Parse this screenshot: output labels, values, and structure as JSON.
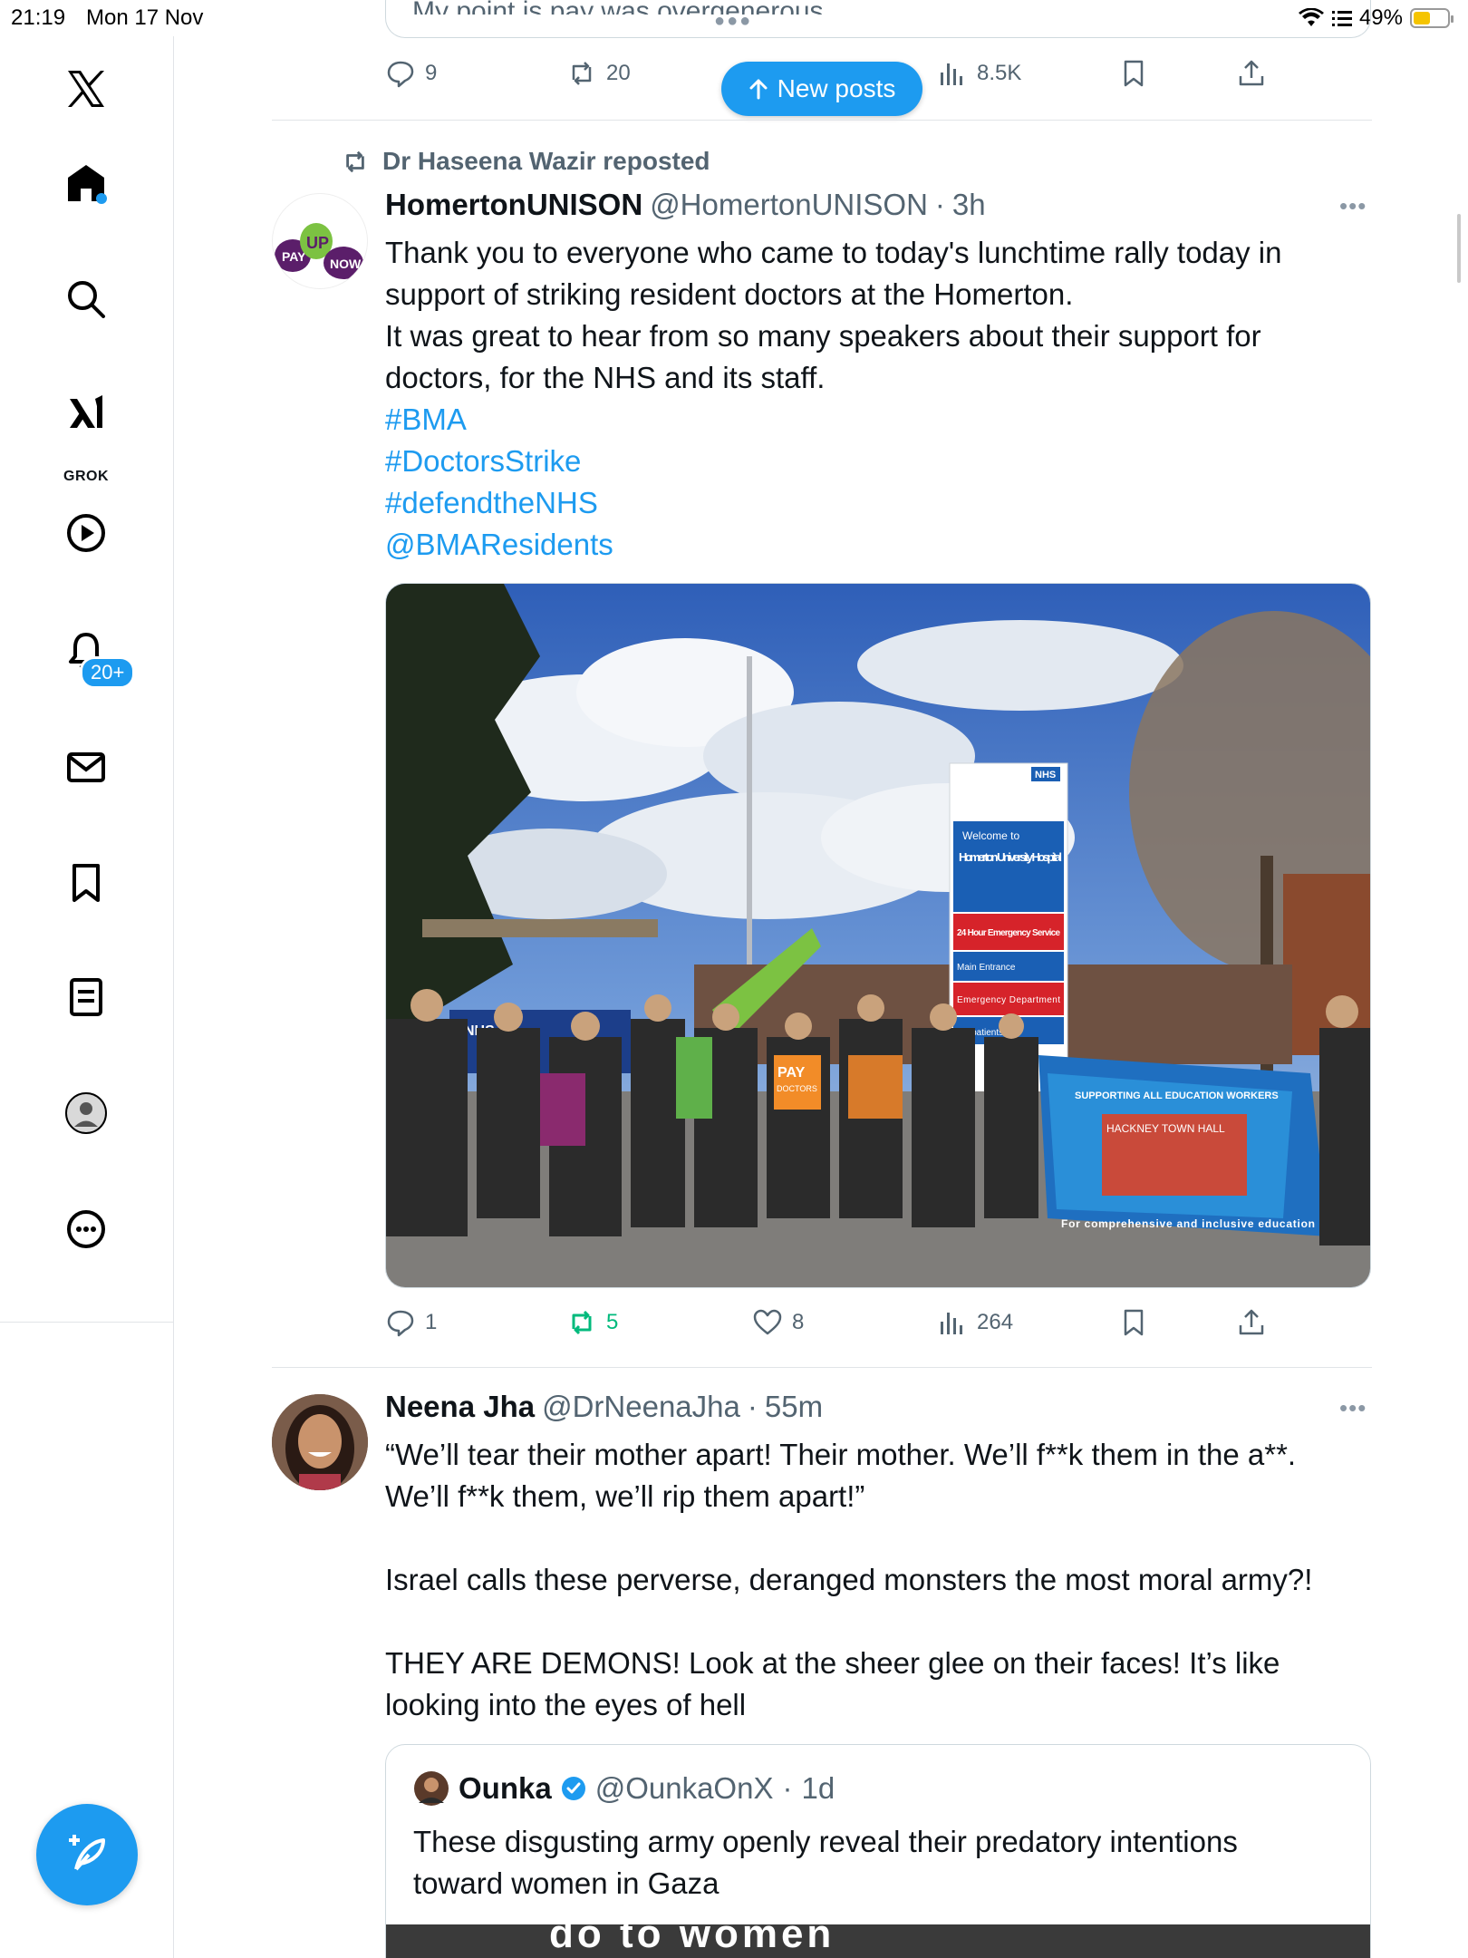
{
  "status_bar": {
    "time": "21:19",
    "date": "Mon 17 Nov",
    "battery": "49%"
  },
  "sidebar": {
    "grok_label": "GROK",
    "notifications_badge": "20+"
  },
  "top_post": {
    "text_fragment": "My point is pay was overgenerous...",
    "replies": "9",
    "reposts": "20",
    "views": "8.5K"
  },
  "new_posts_label": "New posts",
  "tweet1": {
    "repost_by": "Dr Haseena Wazir reposted",
    "name": "HomertonUNISON",
    "handle": "@HomertonUNISON",
    "time": "3h",
    "lines": [
      "Thank you to everyone who came to today's lunchtime rally today in",
      "support of striking resident doctors at the Homerton.",
      "It was great to hear from so many speakers about their support for",
      "doctors, for the NHS and its staff."
    ],
    "links": [
      "#BMA",
      "#DoctorsStrike",
      "#defendtheNHS",
      "@BMAResidents"
    ],
    "avatar_text": {
      "pay": "PAY",
      "up": "UP",
      "now": "NOW"
    },
    "photo_sign": {
      "nhs": "NHS",
      "welcome": "Welcome to",
      "hospital": "Homerton University Hospital",
      "emergency": "24 Hour Emergency Service",
      "main_entrance": "Main Entrance",
      "emergency_dept": "Emergency Department",
      "outpatients": "Outpatients",
      "banner": "For comprehensive and inclusive education",
      "banner_top": "SUPPORTING ALL EDUCATION WORKERS",
      "town_hall": "HACKNEY TOWN HALL",
      "pay_placard": "PAY",
      "doctors_placard": "DOCTORS",
      "nhs_banner": "NHS"
    },
    "replies": "1",
    "reposts": "5",
    "likes": "8",
    "views": "264"
  },
  "tweet2": {
    "name": "Neena Jha",
    "handle": "@DrNeenaJha",
    "time": "55m",
    "line1": "“We’ll tear their mother apart! Their mother. We’ll f**k them in the a**.",
    "line2": "We’ll f**k them, we’ll rip them apart!”",
    "line3": "Israel calls these perverse, deranged monsters the most moral army?!",
    "line4": "THEY ARE DEMONS! Look at the sheer glee on their faces! It’s like",
    "line5": "looking into the eyes of hell",
    "quote": {
      "name": "Ounka",
      "handle": "@OunkaOnX",
      "time": "1d",
      "line1": "These disgusting army openly reveal their predatory intentions",
      "line2": "toward women in Gaza",
      "media_caption": "do to women"
    }
  },
  "colors": {
    "accent": "#1d9bf0",
    "repost_green": "#00ba7c",
    "muted": "#536471"
  }
}
